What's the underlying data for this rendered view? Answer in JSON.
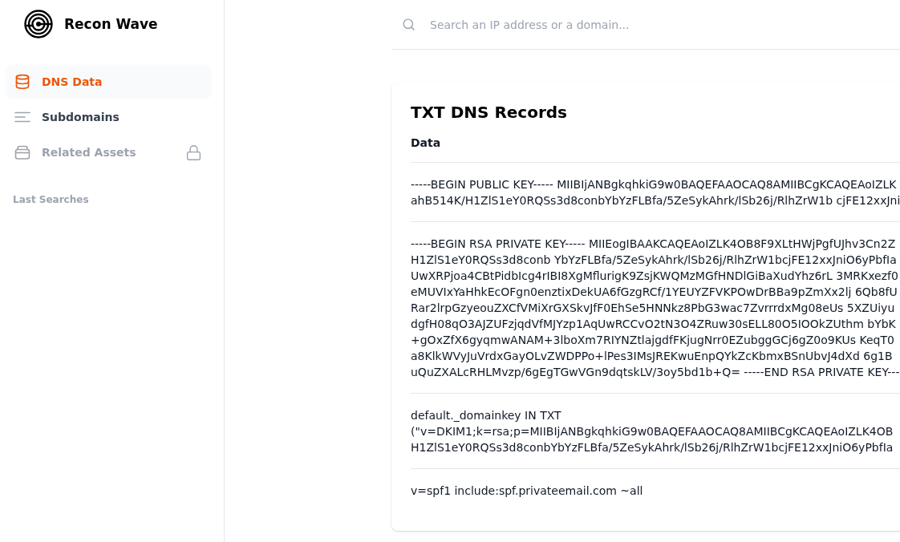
{
  "sidebar": {
    "brand": "Recon Wave",
    "nav": [
      {
        "label": "DNS Data",
        "kind": "database",
        "selected": true,
        "locked": false
      },
      {
        "label": "Subdomains",
        "kind": "lines",
        "selected": false,
        "locked": false
      },
      {
        "label": "Related Assets",
        "kind": "stack",
        "selected": false,
        "locked": true
      }
    ],
    "section_title": "Last Searches"
  },
  "search": {
    "placeholder": "Search an IP address or a domain..."
  },
  "records_card": {
    "title": "TXT DNS Records",
    "columns": [
      "Data"
    ],
    "rows": [
      {
        "lines": [
          "-----BEGIN PUBLIC KEY----- MIIBIjANBgkqhkiG9w0BAQEFAAOCAQ8AMIIBCgKCAQEAoIZLK",
          "ahB514K/H1ZlS1eY0RQSs3d8conbYbYzFLBfa/5ZeSykAhrk/lSb26j/RlhZrW1b cjFE12xxJni"
        ]
      },
      {
        "lines": [
          "-----BEGIN RSA PRIVATE KEY----- MIIEogIBAAKCAQEAoIZLK4OB8F9XLtHWjPgfUJhv3Cn2Z",
          "H1ZlS1eY0RQSs3d8conb YbYzFLBfa/5ZeSykAhrk/lSb26j/RlhZrW1bcjFE12xxJniO6yPbfIa",
          "UwXRPjoa4CBtPidbIcg4rIBI8XgMflurigK9ZsjKWQMzMGfHNDlGiBaXudYhz6rL 3MRKxezf0",
          "eMUVIxYaHhkEcOFgn0enztixDekUA6fGzgRCf/1YEUYZFVKPOwDrBBa9pZmXx2lj 6Qb8fU",
          "Rar2lrpGzyeouZXCfVMiXrGXSkvJfF0EhSe5HNNkz8PbG3wac7ZvrrrdxMg08eUs 5XZUiyu",
          "dgfH08qO3AJZUFzjqdVfMJYzp1AqUwRCCvO2tN3O4ZRuw30sELL80O5IOOkZUthm bYbK",
          "+gOxZfX6gyqmwANAM+3lboXm7RIYNZtlajgdfFKjugNrr0EZubggGCj6gZ0o9KUs KeqT0",
          "a8KlkWVyJuVrdxGayOLvZWDPPo+lPes3IMsJREKwuEnpQYkZcKbmxBSnUbvJ4dXd 6g1B",
          "uQuZXALcRHLMvzp/6gEgTGwVGn9dqtskLV/3oy5bd1b+Q= -----END RSA PRIVATE KEY---"
        ]
      },
      {
        "lines": [
          "default._domainkey IN TXT",
          "(\"v=DKIM1;k=rsa;p=MIIBIjANBgkqhkiG9w0BAQEFAAOCAQ8AMIIBCgKCAQEAoIZLK4OB",
          "H1ZlS1eY0RQSs3d8conbYbYzFLBfa/5ZeSykAhrk/lSb26j/RlhZrW1bcjFE12xxJniO6yPbfIa"
        ]
      },
      {
        "lines": [
          "v=spf1 include:spf.privateemail.com ~all"
        ]
      }
    ]
  }
}
